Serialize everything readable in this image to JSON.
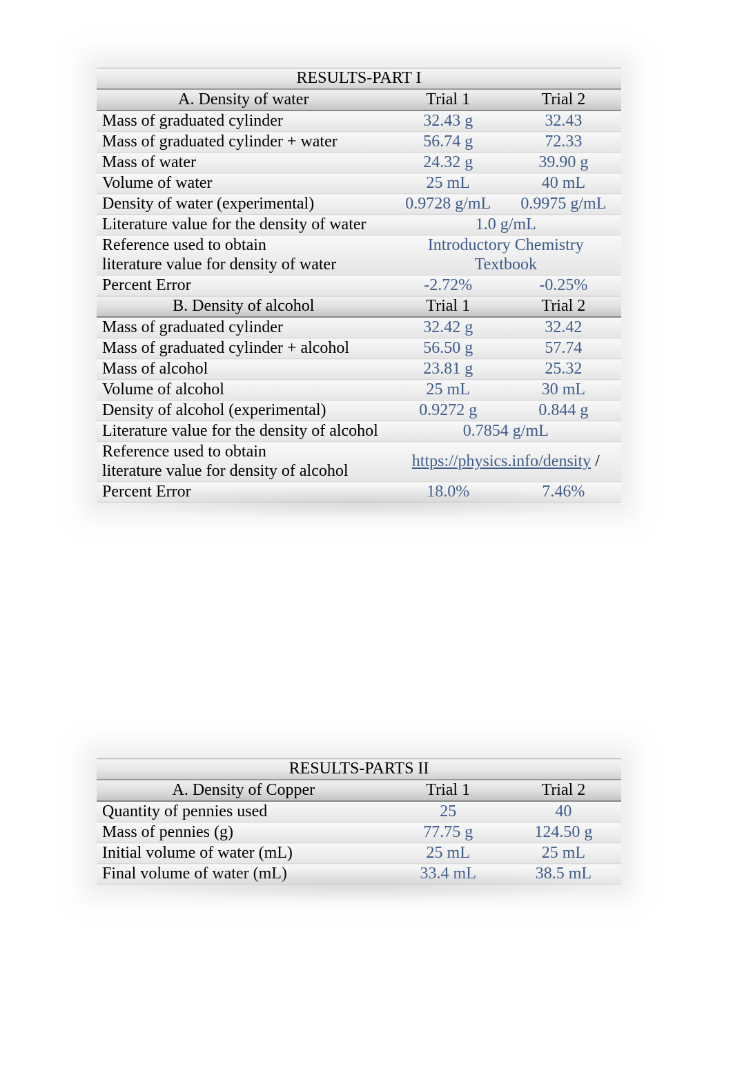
{
  "table1": {
    "title": "RESULTS-PART I",
    "sectionA": {
      "heading": "A. Density of water",
      "trial1": "Trial 1",
      "trial2": "Trial 2",
      "rows": [
        {
          "label": "Mass of graduated cylinder",
          "t1": "32.43 g",
          "t2": "32.43"
        },
        {
          "label": "Mass of graduated cylinder + water",
          "t1": "56.74 g",
          "t2": "72.33"
        },
        {
          "label": "Mass of water",
          "t1": "24.32 g",
          "t2": "39.90 g"
        },
        {
          "label": "Volume of water",
          "t1": "25 mL",
          "t2": "40 mL"
        },
        {
          "label": "Density of water (experimental)",
          "t1": "0.9728 g/mL",
          "t2": "0.9975 g/mL"
        }
      ],
      "lit_label": "Literature value for the density of water",
      "lit_value": "1.0 g/mL",
      "ref_label_l1": "Reference used to obtain",
      "ref_label_l2": "literature value for density of water",
      "ref_value_l1": "Introductory Chemistry",
      "ref_value_l2": "Textbook",
      "pe_label": "Percent Error",
      "pe_t1": "-2.72%",
      "pe_t2": "-0.25%"
    },
    "sectionB": {
      "heading": "B. Density of alcohol",
      "trial1": "Trial 1",
      "trial2": "Trial 2",
      "rows": [
        {
          "label": "Mass of graduated cylinder",
          "t1": "32.42 g",
          "t2": "32.42"
        },
        {
          "label": "Mass of graduated cylinder + alcohol",
          "t1": "56.50 g",
          "t2": "57.74"
        },
        {
          "label": "Mass of alcohol",
          "t1": "23.81 g",
          "t2": "25.32"
        },
        {
          "label": "Volume of alcohol",
          "t1": "25 mL",
          "t2": "30 mL"
        },
        {
          "label": "Density of alcohol (experimental)",
          "t1": "0.9272 g",
          "t2": "0.844 g"
        }
      ],
      "lit_label": "Literature value for the density of alcohol",
      "lit_value": "0.7854 g/mL",
      "ref_label_l1": "Reference used to obtain",
      "ref_label_l2": "literature value for density of alcohol",
      "ref_link": "https://physics.info/density",
      "ref_suffix": "  /",
      "pe_label": "Percent Error",
      "pe_t1": "18.0%",
      "pe_t2": "7.46%"
    }
  },
  "table2": {
    "title": "RESULTS-PARTS II",
    "sectionA": {
      "heading": "A. Density of Copper",
      "trial1": "Trial 1",
      "trial2": "Trial 2",
      "rows": [
        {
          "label": "Quantity of pennies used",
          "t1": "25",
          "t2": "40"
        },
        {
          "label": "Mass of pennies (g)",
          "t1": "77.75 g",
          "t2": "124.50 g"
        },
        {
          "label": "Initial volume of water (mL)",
          "t1": "25 mL",
          "t2": "25 mL"
        },
        {
          "label": "Final volume of water (mL)",
          "t1": "33.4 mL",
          "t2": "38.5 mL"
        }
      ]
    }
  }
}
